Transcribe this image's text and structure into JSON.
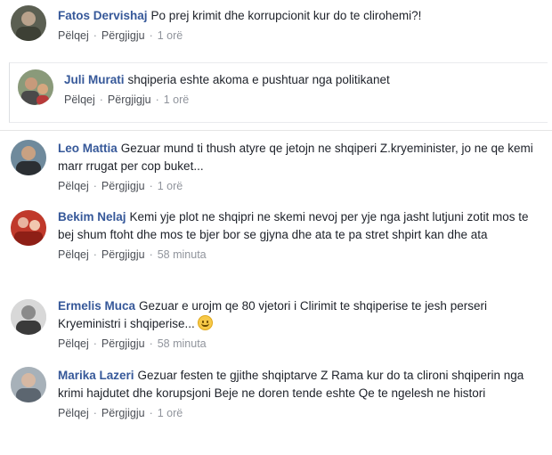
{
  "actions": {
    "like": "Pëlqej",
    "reply": "Përgjigju",
    "separator": "·"
  },
  "comments": [
    {
      "author": "Fatos Dervishaj",
      "text": "Po prej krimit dhe korrupcionit kur do te clirohemi?!",
      "time": "1 orë"
    },
    {
      "author": "Juli Murati",
      "text": "shqiperia eshte akoma e pushtuar nga politikanet",
      "time": "1 orë"
    },
    {
      "author": "Leo Mattia",
      "text": "Gezuar mund ti thush atyre qe jetojn ne shqiperi Z.kryeminister, jo ne qe kemi marr rrugat per cop buket...",
      "time": "1 orë"
    },
    {
      "author": "Bekim Nelaj",
      "text": "Kemi yje plot ne shqipri ne skemi nevoj per yje nga jasht lutjuni zotit mos te bej shum ftoht dhe mos te bjer bor se gjyna dhe ata te pa stret shpirt kan dhe ata",
      "time": "58 minuta"
    },
    {
      "author": "Ermelis Muca",
      "text": "Gezuar e urojm qe 80 vjetori i Clirimit te shqiperise te jesh perseri Kryeministri i shqiperise...",
      "time": "58 minuta"
    },
    {
      "author": "Marika Lazeri",
      "text": "Gezuar festen te gjithe shqiptarve Z Rama kur do ta clironi shqiperin nga krimi hajdutet dhe korupsjoni Beje ne doren tende eshte Qe te ngelesh ne histori",
      "time": "1 orë"
    }
  ],
  "colors": {
    "author": "#365899",
    "meta": "#90949c",
    "text": "#1d2129"
  }
}
